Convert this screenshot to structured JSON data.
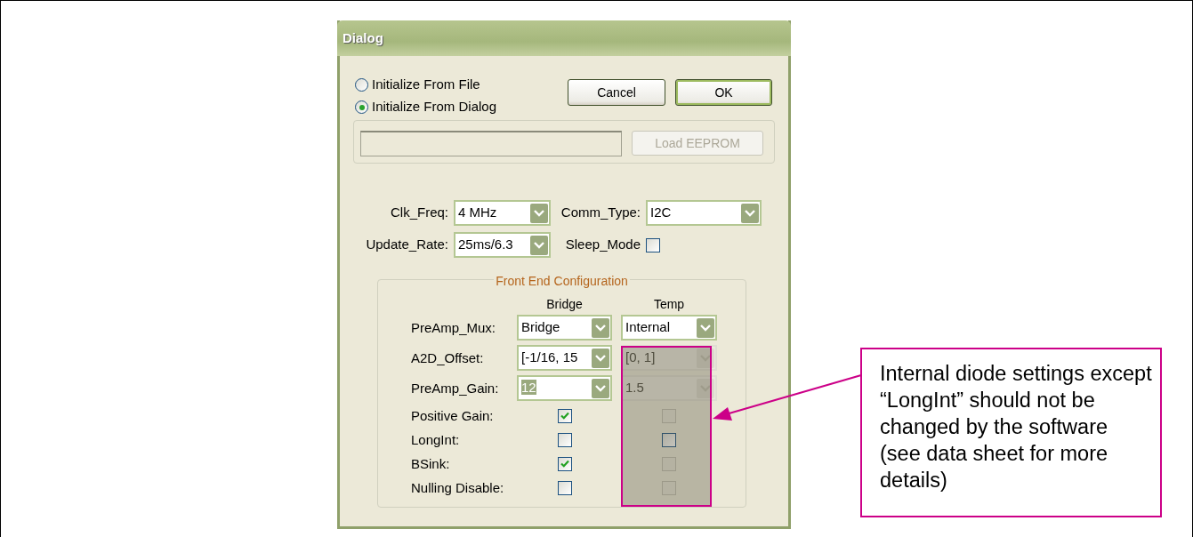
{
  "window": {
    "title": "Dialog"
  },
  "init_options": [
    {
      "label": "Initialize From File",
      "selected": false
    },
    {
      "label": "Initialize From Dialog",
      "selected": true
    }
  ],
  "buttons": [
    {
      "label": "Cancel",
      "default": false
    },
    {
      "label": "OK",
      "default": true
    }
  ],
  "load_button": {
    "label": "Load EEPROM",
    "disabled": true
  },
  "settings": [
    {
      "kind": "select",
      "label": "Clk_Freq:",
      "value": "4 MHz"
    },
    {
      "kind": "select",
      "label": "Comm_Type:",
      "value": "I2C"
    },
    {
      "kind": "select",
      "label": "Update_Rate:",
      "value": "25ms/6.3"
    },
    {
      "kind": "checkbox",
      "label": "Sleep_Mode",
      "checked": false
    }
  ],
  "front_end": {
    "title": "Front End Configuration",
    "columns": [
      "Bridge",
      "Temp"
    ],
    "rows": [
      {
        "kind": "select",
        "label": "PreAmp_Mux:",
        "cells": [
          {
            "value": "Bridge",
            "disabled": false,
            "highlighted": false
          },
          {
            "value": "Internal",
            "disabled": false,
            "highlighted": false
          }
        ]
      },
      {
        "kind": "select",
        "label": "A2D_Offset:",
        "cells": [
          {
            "value": "[-1/16, 15",
            "disabled": false,
            "highlighted": false
          },
          {
            "value": "[0, 1]",
            "disabled": true,
            "highlighted": false
          }
        ]
      },
      {
        "kind": "select",
        "label": "PreAmp_Gain:",
        "cells": [
          {
            "value": "12",
            "disabled": false,
            "highlighted": true
          },
          {
            "value": "1.5",
            "disabled": true,
            "highlighted": false
          }
        ]
      },
      {
        "kind": "checkbox",
        "label": "Positive Gain:",
        "cells": [
          {
            "checked": true,
            "disabled": false
          },
          {
            "checked": false,
            "disabled": true
          }
        ]
      },
      {
        "kind": "checkbox",
        "label": "LongInt:",
        "cells": [
          {
            "checked": false,
            "disabled": false
          },
          {
            "checked": false,
            "disabled": false
          }
        ]
      },
      {
        "kind": "checkbox",
        "label": "BSink:",
        "cells": [
          {
            "checked": true,
            "disabled": false
          },
          {
            "checked": false,
            "disabled": true
          }
        ]
      },
      {
        "kind": "checkbox",
        "label": "Nulling Disable:",
        "cells": [
          {
            "checked": false,
            "disabled": false
          },
          {
            "checked": false,
            "disabled": true
          }
        ]
      }
    ]
  },
  "callout": {
    "text": "Internal diode settings except “LongInt” should not be changed by the software (see data sheet for more details)"
  }
}
